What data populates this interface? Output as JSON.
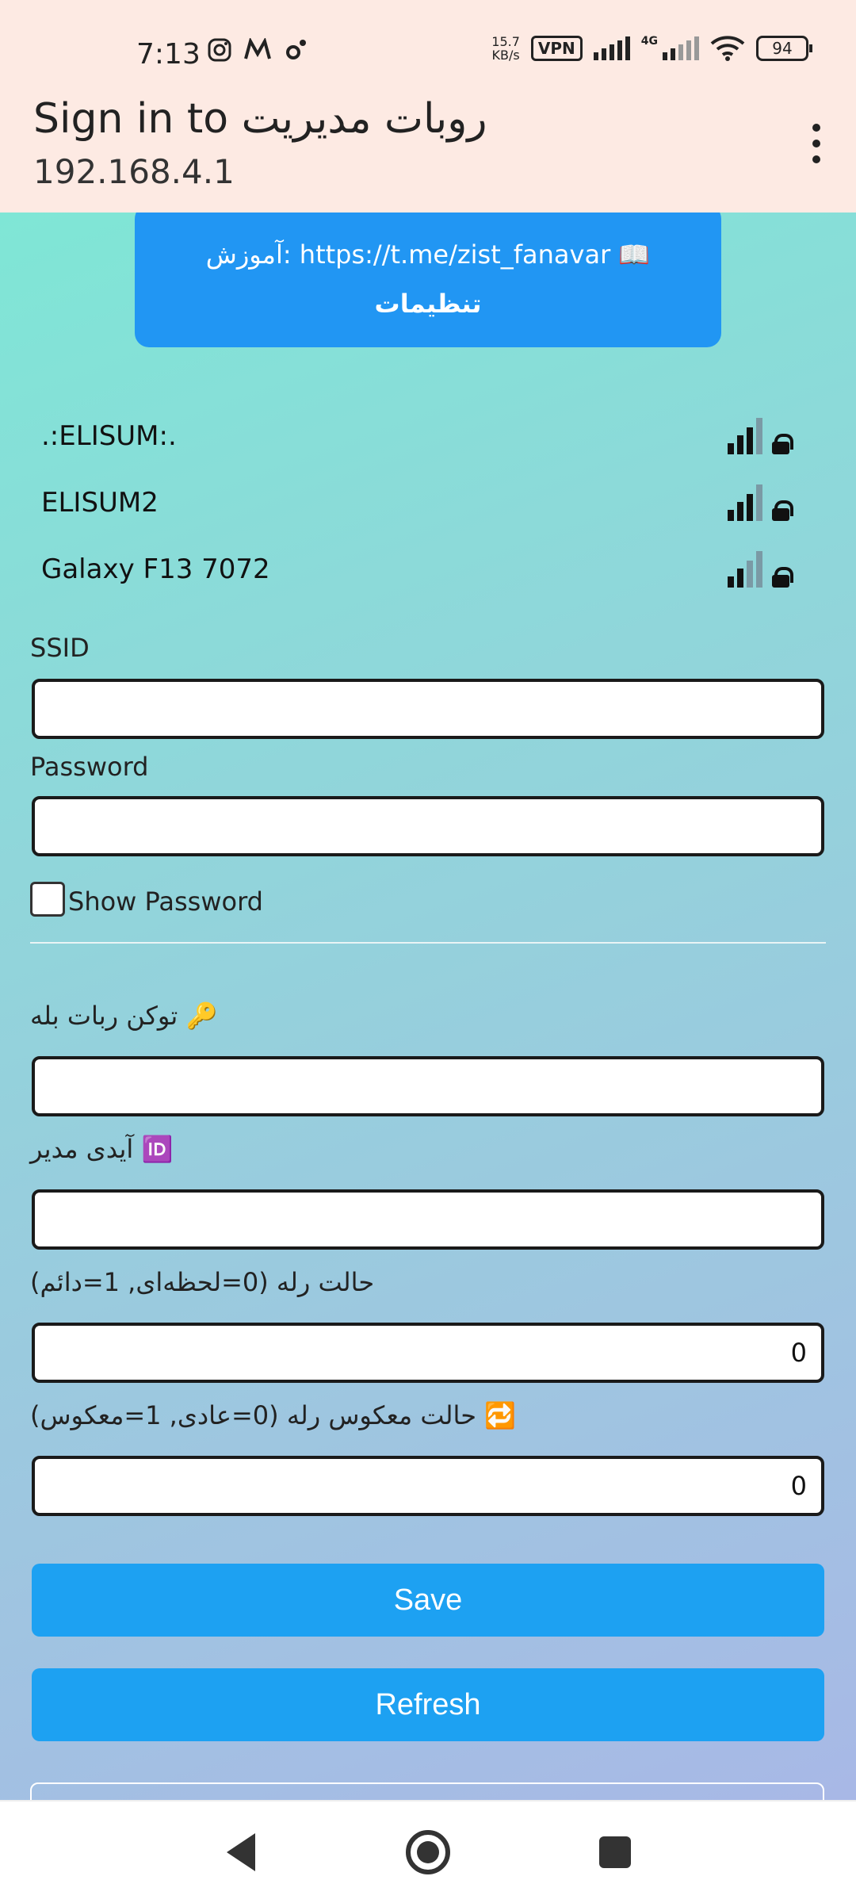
{
  "status_bar": {
    "time": "7:13",
    "net_speed_value": "15.7",
    "net_speed_unit": "KB/s",
    "vpn": "VPN",
    "network_type": "4G",
    "battery": "94",
    "left_icons": [
      "instagram-icon",
      "medium-icon",
      "settings-sync-icon"
    ]
  },
  "app_bar": {
    "title": "Sign in to روبات مدیریت",
    "subtitle": "192.168.4.1"
  },
  "banner": {
    "line1": "آموزش: https://t.me/zist_fanavar 📖",
    "line2": "تنظیمات"
  },
  "wifi_networks": [
    {
      "ssid": ".:ELISUM:.",
      "signal_bars": 3,
      "locked": true
    },
    {
      "ssid": "ELISUM2",
      "signal_bars": 3,
      "locked": true
    },
    {
      "ssid": "Galaxy F13 7072",
      "signal_bars": 2,
      "locked": true
    }
  ],
  "form": {
    "ssid_label": "SSID",
    "ssid_value": "",
    "password_label": "Password",
    "password_value": "",
    "show_password_label": "Show Password",
    "token_label": "🔑 توکن ربات بله",
    "token_value": "",
    "admin_id_label": "🆔 آیدی مدیر",
    "admin_id_value": "",
    "relay_mode_label": "حالت رله (0=لحظه‌ای, 1=دائم)",
    "relay_mode_value": "0",
    "relay_inverse_label": "🔁 حالت معکوس رله (0=عادی, 1=معکوس)",
    "relay_inverse_value": "0"
  },
  "buttons": {
    "save": "Save",
    "refresh": "Refresh"
  },
  "colors": {
    "banner": "#2196f3",
    "button": "#1da1f2",
    "header_bg": "#fdeae3"
  }
}
